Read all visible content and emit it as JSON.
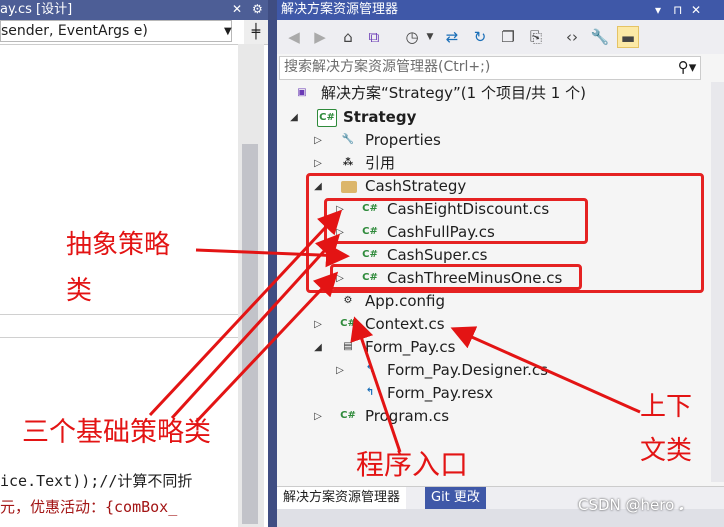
{
  "editor": {
    "tab_title": "ay.cs [设计]",
    "tab_close": "✕",
    "tab_pin": "⚙",
    "member_dropdown": "sender, EventArgs e)",
    "split_icon": "split-icon",
    "code_line_1": "ice.Text));//计算不同折",
    "code_line_2": "元，优惠活动：{comBox_"
  },
  "solution_explorer": {
    "title": "解决方案资源管理器",
    "title_controls": [
      "▾",
      "⊓",
      "✕"
    ],
    "search_placeholder": "搜索解决方案资源管理器(Ctrl+;)",
    "toolbar_icons": [
      "back-icon",
      "forward-icon",
      "home-icon",
      "vs-icon",
      "history-icon",
      "sync-icon",
      "refresh-icon",
      "collapse-icon",
      "copy-icon",
      "code-icon",
      "wrench-icon",
      "preview-icon"
    ],
    "tree": {
      "solution": "解决方案“Strategy”(1 个项目/共 1 个)",
      "project": "Strategy",
      "properties": "Properties",
      "references": "引用",
      "folder": "CashStrategy",
      "f1": "CashEightDiscount.cs",
      "f2": "CashFullPay.cs",
      "f3": "CashSuper.cs",
      "f4": "CashThreeMinusOne.cs",
      "app_config": "App.config",
      "context": "Context.cs",
      "form_pay": "Form_Pay.cs",
      "form_pay_designer": "Form_Pay.Designer.cs",
      "form_pay_resx": "Form_Pay.resx",
      "program": "Program.cs"
    },
    "bottom_tabs": [
      "解决方案资源管理器",
      "Git 更改"
    ]
  },
  "annotations": {
    "abstract_1": "抽象策略",
    "abstract_2": "类",
    "three_basic": "三个基础策略类",
    "entry": "程序入口",
    "context_1": "上下",
    "context_2": "文类"
  },
  "watermark": "CSDN @hero 𝅘",
  "colors": {
    "annotation_red": "#e31414",
    "title_blue": "#3f58a8",
    "csharp_green": "#2e8a3a"
  }
}
